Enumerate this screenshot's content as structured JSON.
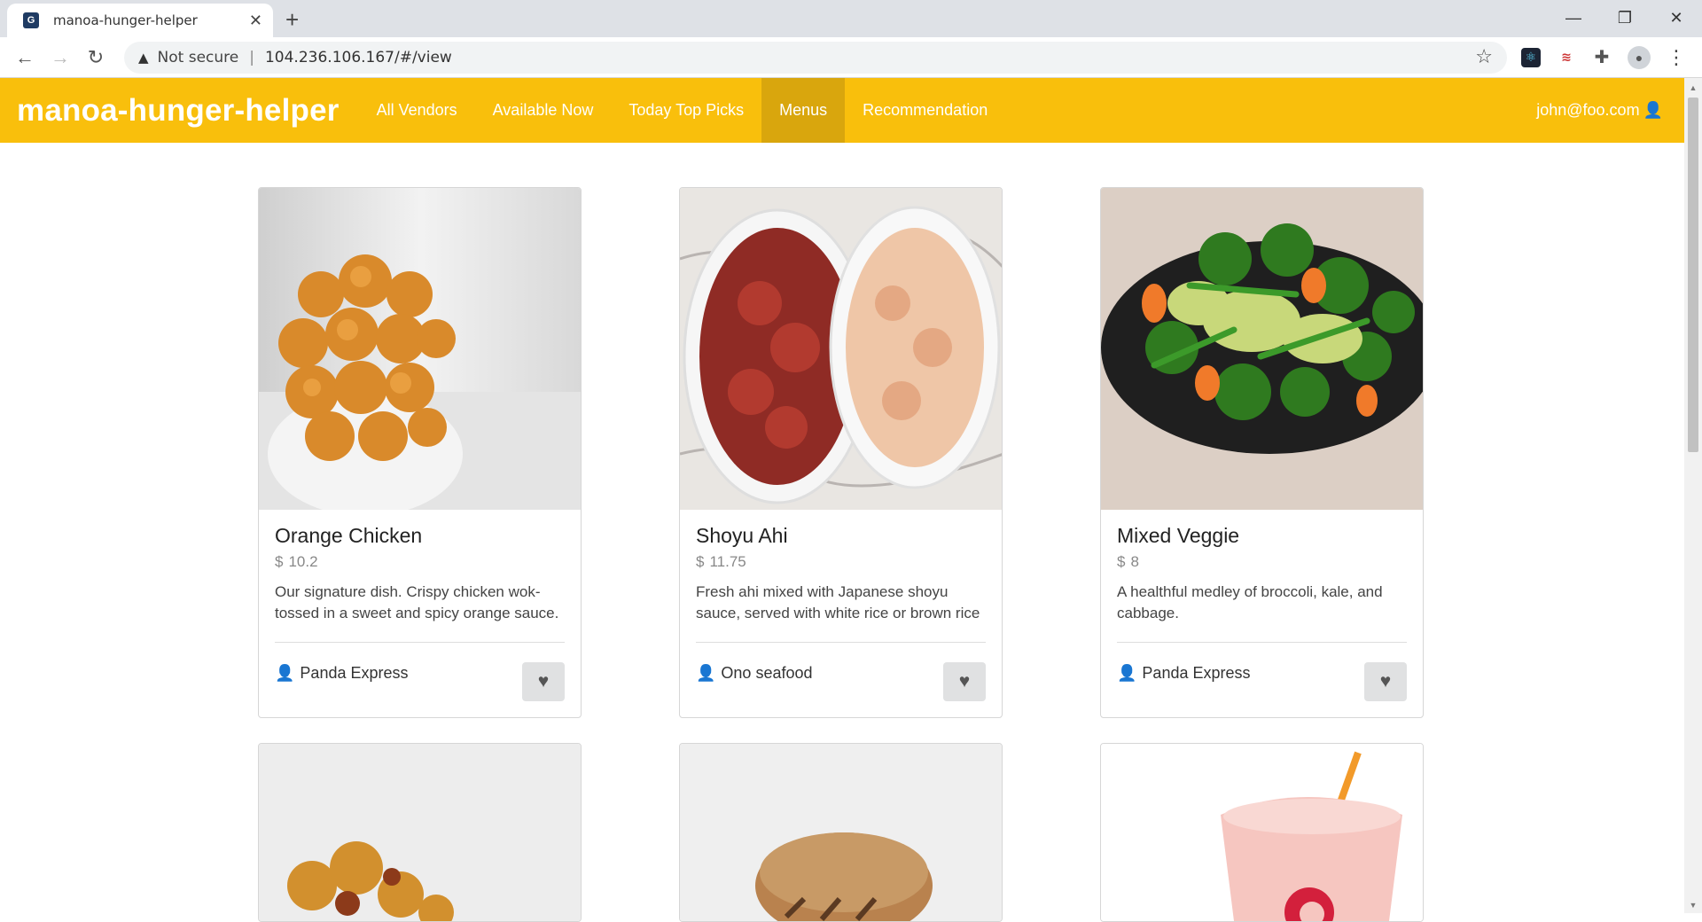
{
  "browser": {
    "tab_title": "manoa-hunger-helper",
    "favicon_letter": "G",
    "security_label": "Not secure",
    "url": "104.236.106.167/#/view"
  },
  "navbar": {
    "brand": "manoa-hunger-helper",
    "links": [
      "All Vendors",
      "Available Now",
      "Today Top Picks",
      "Menus",
      "Recommendation"
    ],
    "active": "Menus",
    "user": "john@foo.com"
  },
  "items": [
    {
      "name": "Orange Chicken",
      "price": "10.2",
      "description": "Our signature dish. Crispy chicken wok-tossed in a sweet and spicy orange sauce.",
      "vendor": "Panda Express"
    },
    {
      "name": "Shoyu Ahi",
      "price": "11.75",
      "description": "Fresh ahi mixed with Japanese shoyu sauce, served with white rice or brown rice",
      "vendor": "Ono seafood"
    },
    {
      "name": "Mixed Veggie",
      "price": "8",
      "description": "A healthful medley of broccoli, kale, and cabbage.",
      "vendor": "Panda Express"
    }
  ],
  "icons": {
    "person": "person-icon",
    "heart": "heart-icon",
    "dollar": "dollar-icon"
  },
  "colors": {
    "navbar": "#f9bf0c",
    "navbar_active": "#d9a60d"
  }
}
